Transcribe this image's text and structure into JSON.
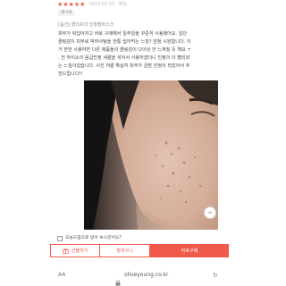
{
  "review": {
    "stars": "★★★★★",
    "rating": 5,
    "date": "2023.07.03 · 메일",
    "tag": "재구매",
    "product_option": "[옵션] 클리프의 당월필마스크",
    "lines": [
      "피부가 뒤집어지고 바로 구매해서 일주일을 꾸준히 사용했어요. 일단",
      "클링감이 피부로 박하사탕을 한통 씹어먹는 느낌? 엄청 시원합니다. 이",
      "거 한번 사용하면 다른 제품들의 클링감이 다이상 안 느껴질 듯 해요 ㅜ",
      ". 전 하이소이 음급진정 세럼을 섞어서 사용하였더니 진정이 더 빨리되",
      "는 느낌이었습니다. 사진 처럼 확실히 피부가 금방 진정이 되었어서 추",
      "천드립니다!!"
    ]
  },
  "photo": {
    "alt": "review-face-photo"
  },
  "save_option": {
    "label": "오늘드림으로 받아 보시겠어요?",
    "checked": false
  },
  "actions": {
    "gift": "선물하기",
    "cart": "장바구니",
    "buy": "바로구매"
  },
  "browser": {
    "aa": "AA",
    "url": "oliveyoung.co.kr"
  },
  "colors": {
    "accent": "#f05a4a"
  },
  "icons": {
    "gift": "gift-icon",
    "lock": "lock-icon",
    "reload": "reload-icon",
    "top": "scroll-top-icon"
  }
}
